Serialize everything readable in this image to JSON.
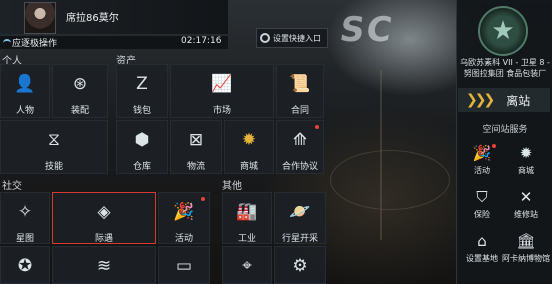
{
  "header": {
    "character_name": "席拉86莫尔",
    "toolbar_label": "应逐极操作",
    "time": "02:17:16",
    "settings_shortcut": "设置快捷入口"
  },
  "sections": {
    "personal": {
      "title": "个人",
      "items": [
        {
          "label": "人物",
          "icon": "person-icon"
        },
        {
          "label": "装配",
          "icon": "fitting-icon"
        },
        {
          "label": "技能",
          "icon": "skill-icon"
        }
      ]
    },
    "assets": {
      "title": "资产",
      "items": [
        {
          "label": "钱包",
          "icon": "wallet-icon"
        },
        {
          "label": "市场",
          "icon": "market-icon"
        },
        {
          "label": "合同",
          "icon": "contract-icon"
        },
        {
          "label": "仓库",
          "icon": "warehouse-icon"
        },
        {
          "label": "物流",
          "icon": "logistics-icon"
        },
        {
          "label": "商城",
          "icon": "store-icon"
        },
        {
          "label": "合作协议",
          "icon": "agreement-icon"
        }
      ]
    },
    "social": {
      "title": "社交",
      "items": [
        {
          "label": "星图",
          "icon": "starmap-icon"
        },
        {
          "label": "际遇",
          "icon": "encounter-icon"
        },
        {
          "label": "活动",
          "icon": "event-icon"
        }
      ]
    },
    "other": {
      "title": "其他",
      "items": [
        {
          "label": "工业",
          "icon": "industry-icon"
        },
        {
          "label": "行星开采",
          "icon": "planet-mining-icon"
        }
      ]
    }
  },
  "right_panel": {
    "station_name": "乌欧苏素科 VII - 卫星 8 - 努图拉集团 食品包装厂",
    "undock_label": "离站",
    "services_title": "空间站服务",
    "services": [
      {
        "label": "活动",
        "icon": "party-icon"
      },
      {
        "label": "商城",
        "icon": "store-icon"
      },
      {
        "label": "保险",
        "icon": "insurance-icon"
      },
      {
        "label": "维修站",
        "icon": "repair-icon"
      },
      {
        "label": "设置基地",
        "icon": "base-icon"
      },
      {
        "label": "阿卡纳博物馆",
        "icon": "museum-icon"
      }
    ]
  },
  "colors": {
    "accent_gold": "#e5b53a",
    "selection_red": "#d63a35",
    "notification_red": "#e2433a"
  }
}
